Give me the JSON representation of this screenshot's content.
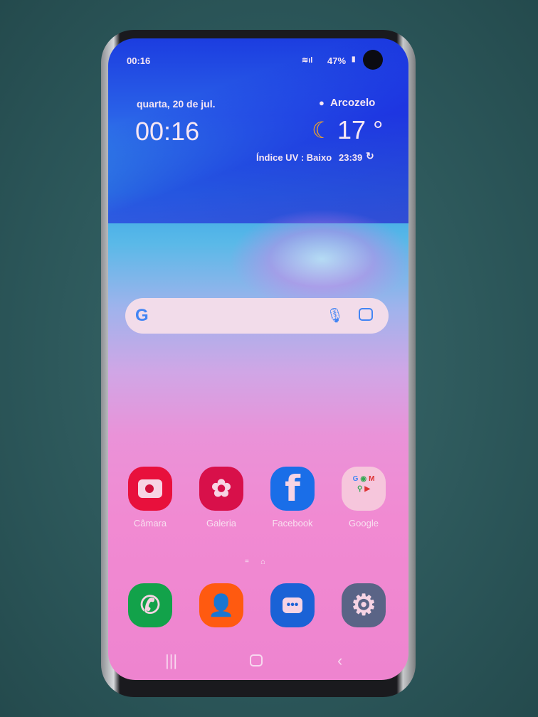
{
  "status_bar": {
    "time": "00:16",
    "battery": "47%",
    "icons": [
      "wifi-icon",
      "signal-icon",
      "battery-icon"
    ]
  },
  "widget": {
    "date": "quarta, 20 de jul.",
    "clock": "00:16",
    "location": "Arcozelo",
    "temperature": "17 °",
    "weather_icon": "moon-icon",
    "uv": "Índice UV : Baixo",
    "updated": "23:39"
  },
  "search": {
    "icons": [
      "google-icon",
      "mic-icon",
      "lens-icon"
    ]
  },
  "apps": [
    {
      "label": "Câmara",
      "color": "#e8103c"
    },
    {
      "label": "Galeria",
      "color": "#d8104a"
    },
    {
      "label": "Facebook",
      "color": "#1a6ee8"
    },
    {
      "label": "Google",
      "color": "#f6c6dc"
    }
  ],
  "dock": [
    {
      "name": "phone",
      "color": "#12a24a"
    },
    {
      "name": "contacts",
      "color": "#ff5a10"
    },
    {
      "name": "messages",
      "color": "#1a62d6"
    },
    {
      "name": "settings",
      "color": "#5a6486"
    }
  ]
}
